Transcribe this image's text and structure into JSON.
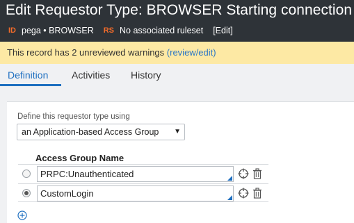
{
  "header": {
    "title": "Edit Requestor Type: BROWSER Starting connection",
    "id_tag": "ID",
    "id_value": "pega • BROWSER",
    "rs_tag": "RS",
    "rs_value": "No associated ruleset",
    "edit_label": "[Edit]"
  },
  "warning": {
    "text": "This record has 2 unreviewed warnings",
    "link": "(review/edit)"
  },
  "tabs": [
    {
      "label": "Definition",
      "active": true
    },
    {
      "label": "Activities",
      "active": false
    },
    {
      "label": "History",
      "active": false
    }
  ],
  "definition": {
    "define_label": "Define this requestor type using",
    "select_value": "an Application-based Access Group",
    "grid_header": "Access Group Name",
    "rows": [
      {
        "value": "PRPC:Unauthenticated",
        "selected": false
      },
      {
        "value": "CustomLogin",
        "selected": true
      }
    ]
  },
  "colors": {
    "header_bg": "#2e3338",
    "tag_orange": "#f26b2a",
    "warning_bg": "#fde9a4",
    "link_blue": "#2a76c6",
    "active_tab": "#1e6fc0"
  },
  "icons": {
    "dropdown": "caret-down-icon",
    "row_target": "crosshair-icon",
    "row_delete": "trash-icon",
    "add_row": "plus-circle-icon"
  }
}
